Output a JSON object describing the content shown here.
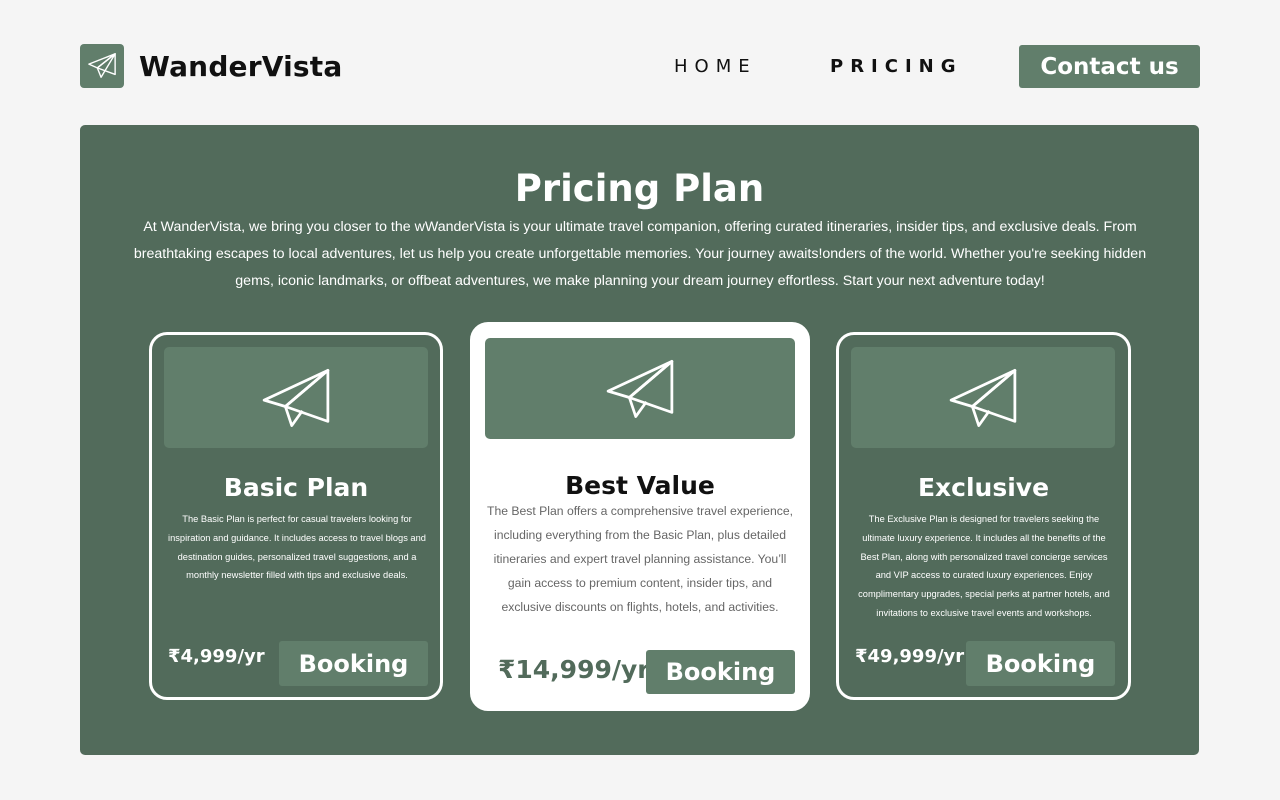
{
  "header": {
    "brand": "WanderVista",
    "logo_icon": "paper-plane-icon",
    "nav": {
      "home": "HOME",
      "pricing": "PRICING"
    },
    "contact_label": "Contact us"
  },
  "main": {
    "title": "Pricing Plan",
    "description": "At WanderVista, we bring you closer to the wWanderVista is your ultimate travel companion, offering curated itineraries, insider tips, and exclusive deals. From breathtaking escapes to local adventures, let us help you create unforgettable memories. Your journey awaits!onders of the world. Whether you're seeking hidden gems, iconic landmarks, or offbeat adventures, we make planning your dream journey effortless. Start your next adventure today!",
    "plans": [
      {
        "title": "Basic Plan",
        "description": "The Basic Plan is perfect for casual travelers looking for inspiration and guidance. It includes access to travel blogs and destination guides, personalized travel suggestions, and a monthly newsletter filled with tips and exclusive deals.",
        "price": "₹4,999/yr",
        "button": "Booking",
        "icon": "paper-plane-icon"
      },
      {
        "title": "Best Value",
        "description": "The Best Plan offers a comprehensive travel experience, including everything from the Basic Plan, plus detailed itineraries and expert travel planning assistance. You’ll gain access to premium content, insider tips, and exclusive discounts on flights, hotels, and activities.",
        "price": "₹14,999/yr",
        "button": "Booking",
        "icon": "paper-plane-icon"
      },
      {
        "title": "Exclusive",
        "description": "The Exclusive Plan is designed for travelers seeking the ultimate luxury experience. It includes all the benefits of the Best Plan, along with personalized travel concierge services and VIP access to curated luxury experiences. Enjoy complimentary upgrades, special perks at partner hotels, and invitations to exclusive travel events and workshops.",
        "price": "₹49,999/yr",
        "button": "Booking",
        "icon": "paper-plane-icon"
      }
    ]
  },
  "colors": {
    "page_bg": "#f5f5f5",
    "panel_bg": "#526b5b",
    "accent": "#617e6b",
    "card_highlight_bg": "#ffffff"
  }
}
